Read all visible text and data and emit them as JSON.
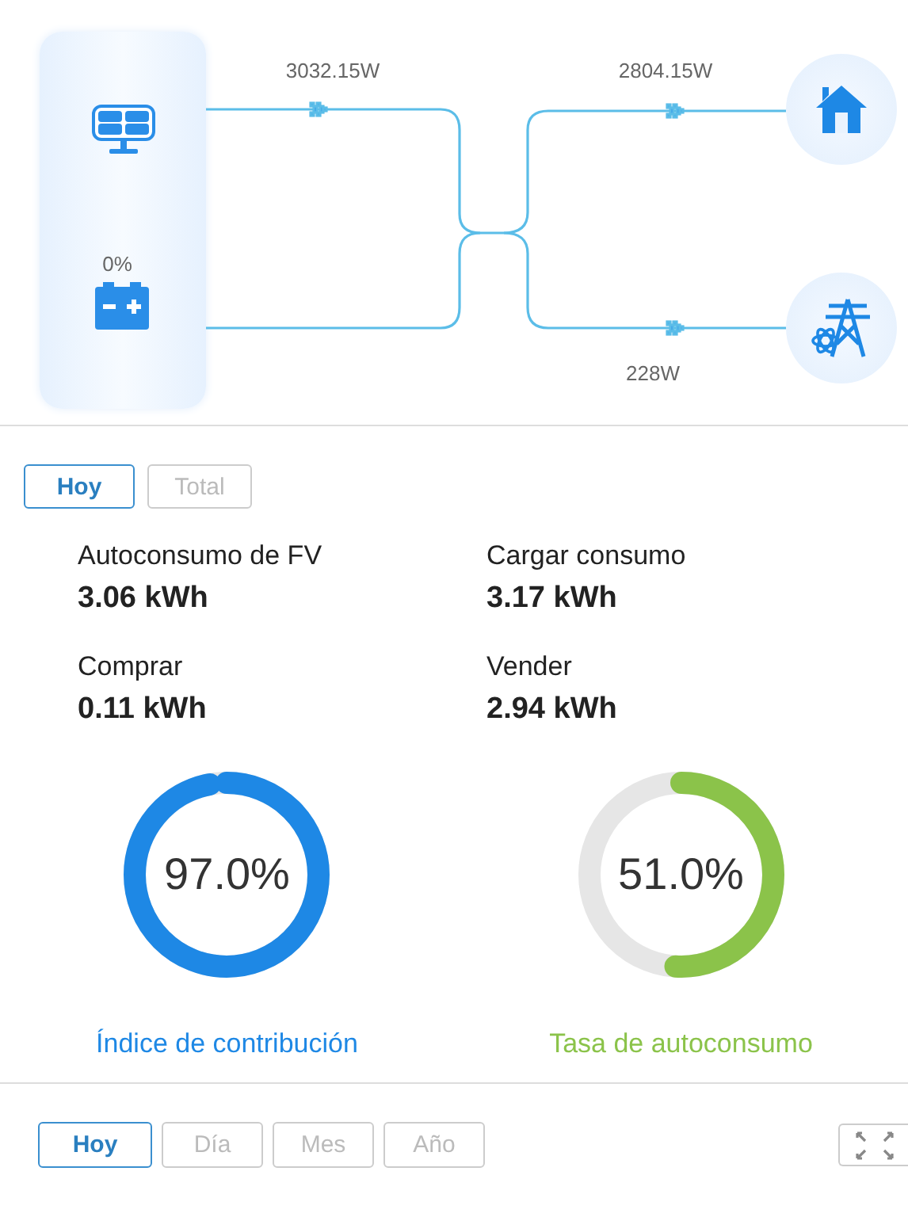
{
  "flow": {
    "solar": {
      "power": "3032.15W"
    },
    "battery": {
      "percent": "0%"
    },
    "home": {
      "power": "2804.15W"
    },
    "grid": {
      "power": "228W"
    }
  },
  "period_tabs": [
    {
      "label": "Hoy",
      "selected": true
    },
    {
      "label": "Total",
      "selected": false
    }
  ],
  "stats": [
    {
      "label": "Autoconsumo de FV",
      "value": "3.06 kWh"
    },
    {
      "label": "Cargar consumo",
      "value": "3.17 kWh"
    },
    {
      "label": "Comprar",
      "value": "0.11 kWh"
    },
    {
      "label": "Vender",
      "value": "2.94 kWh"
    }
  ],
  "gauges": [
    {
      "value": "97.0%",
      "level": 0.97,
      "label": "Índice de contribución",
      "color": "#1e88e5"
    },
    {
      "value": "51.0%",
      "level": 0.51,
      "label": "Tasa de autoconsumo",
      "color": "#8bc34a"
    }
  ],
  "chart_tabs": [
    {
      "label": "Hoy",
      "selected": true
    },
    {
      "label": "Día",
      "selected": false
    },
    {
      "label": "Mes",
      "selected": false
    },
    {
      "label": "Año",
      "selected": false
    }
  ]
}
